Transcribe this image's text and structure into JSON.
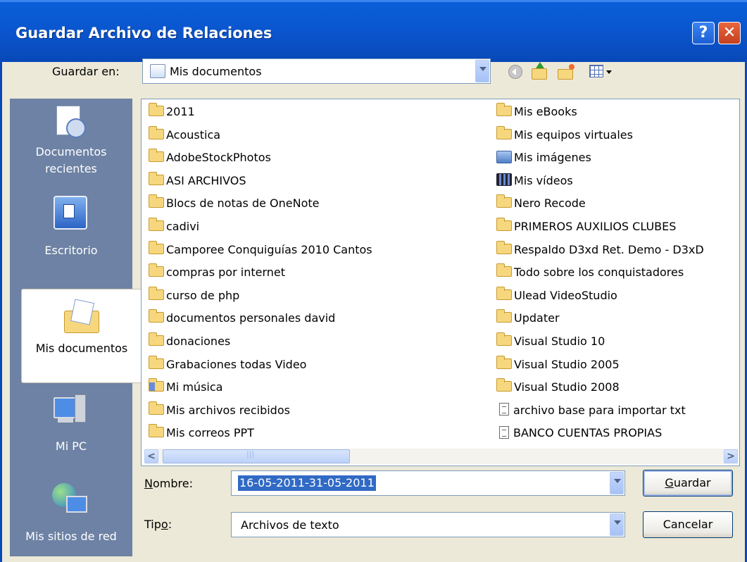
{
  "window": {
    "title": "Guardar Archivo de Relaciones",
    "help_label": "?",
    "close_label": "✕"
  },
  "savein": {
    "label": "Guardar en:",
    "value": "Mis documentos"
  },
  "toolbar": {
    "icons": [
      "back-icon",
      "up-folder-icon",
      "new-folder-icon",
      "views-menu-icon"
    ]
  },
  "places": [
    {
      "label_line1": "Documentos",
      "label_line2": "recientes",
      "icon": "recent-documents-icon"
    },
    {
      "label_line1": "Escritorio",
      "label_line2": "",
      "icon": "desktop-icon"
    },
    {
      "label_line1": "Mis documentos",
      "label_line2": "",
      "icon": "my-documents-icon"
    },
    {
      "label_line1": "Mi PC",
      "label_line2": "",
      "icon": "my-computer-icon"
    },
    {
      "label_line1": "Mis sitios de red",
      "label_line2": "",
      "icon": "network-places-icon"
    }
  ],
  "files_left": [
    {
      "name": "2011",
      "type": "folder"
    },
    {
      "name": "Acoustica",
      "type": "folder"
    },
    {
      "name": "AdobeStockPhotos",
      "type": "folder"
    },
    {
      "name": "ASI ARCHIVOS",
      "type": "folder"
    },
    {
      "name": "Blocs de notas de OneNote",
      "type": "folder"
    },
    {
      "name": "cadivi",
      "type": "folder"
    },
    {
      "name": "Camporee Conquiguías 2010 Cantos",
      "type": "folder"
    },
    {
      "name": "compras por internet",
      "type": "folder"
    },
    {
      "name": "curso de php",
      "type": "folder"
    },
    {
      "name": "documentos personales david",
      "type": "folder"
    },
    {
      "name": "donaciones",
      "type": "folder"
    },
    {
      "name": "Grabaciones todas Video",
      "type": "folder"
    },
    {
      "name": "Mi música",
      "type": "music-folder"
    },
    {
      "name": "Mis archivos recibidos",
      "type": "folder"
    },
    {
      "name": "Mis correos PPT",
      "type": "folder"
    }
  ],
  "files_right": [
    {
      "name": "Mis eBooks",
      "type": "folder"
    },
    {
      "name": "Mis equipos virtuales",
      "type": "folder"
    },
    {
      "name": "Mis imágenes",
      "type": "pictures-folder"
    },
    {
      "name": "Mis vídeos",
      "type": "videos-folder"
    },
    {
      "name": "Nero Recode",
      "type": "folder"
    },
    {
      "name": "PRIMEROS AUXILIOS CLUBES",
      "type": "folder"
    },
    {
      "name": "Respaldo D3xd Ret. Demo - D3xD",
      "type": "folder"
    },
    {
      "name": "Todo sobre los conquistadores",
      "type": "folder"
    },
    {
      "name": "Ulead VideoStudio",
      "type": "folder"
    },
    {
      "name": "Updater",
      "type": "folder"
    },
    {
      "name": "Visual Studio 10",
      "type": "folder"
    },
    {
      "name": "Visual Studio 2005",
      "type": "folder"
    },
    {
      "name": "Visual Studio 2008",
      "type": "folder"
    },
    {
      "name": "archivo base para importar txt",
      "type": "text-file"
    },
    {
      "name": "BANCO CUENTAS PROPIAS",
      "type": "text-file"
    }
  ],
  "filename": {
    "label_u": "N",
    "label_rest": "ombre:",
    "value": "16-05-2011-31-05-2011"
  },
  "filetype": {
    "label_pre": "Tip",
    "label_u": "o",
    "label_rest": ":",
    "value": "Archivos de texto"
  },
  "buttons": {
    "save_u": "G",
    "save_rest": "uardar",
    "cancel": "Cancelar"
  },
  "scroll": {
    "left_arrow": "<",
    "right_arrow": ">"
  }
}
